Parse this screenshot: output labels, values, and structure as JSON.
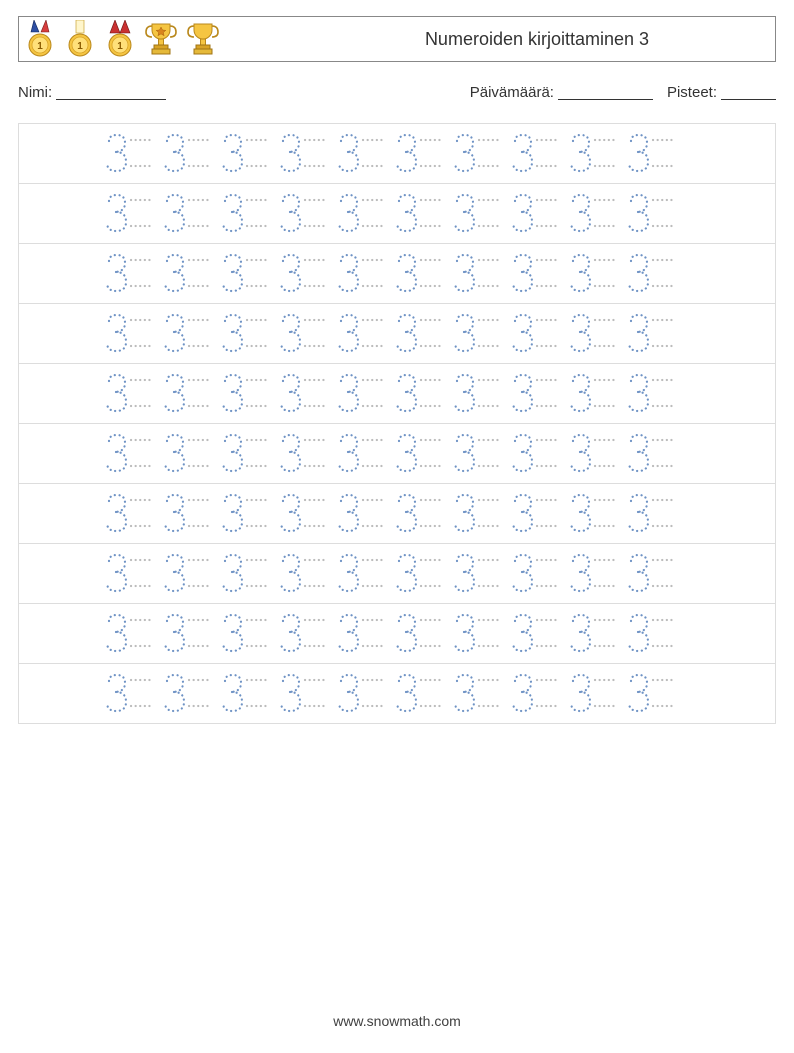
{
  "header": {
    "title": "Numeroiden kirjoittaminen 3"
  },
  "info": {
    "name_label": "Nimi:",
    "date_label": "Päivämäärä:",
    "score_label": "Pisteet:"
  },
  "practice": {
    "digit": "3",
    "rows": 10,
    "cols": 10
  },
  "footer": {
    "site": "www.snowmath.com"
  },
  "icons": {
    "medal1": "medal-icon",
    "medal2": "medal-icon",
    "medal3": "medal-icon",
    "trophy1": "trophy-icon",
    "trophy2": "trophy-icon"
  }
}
